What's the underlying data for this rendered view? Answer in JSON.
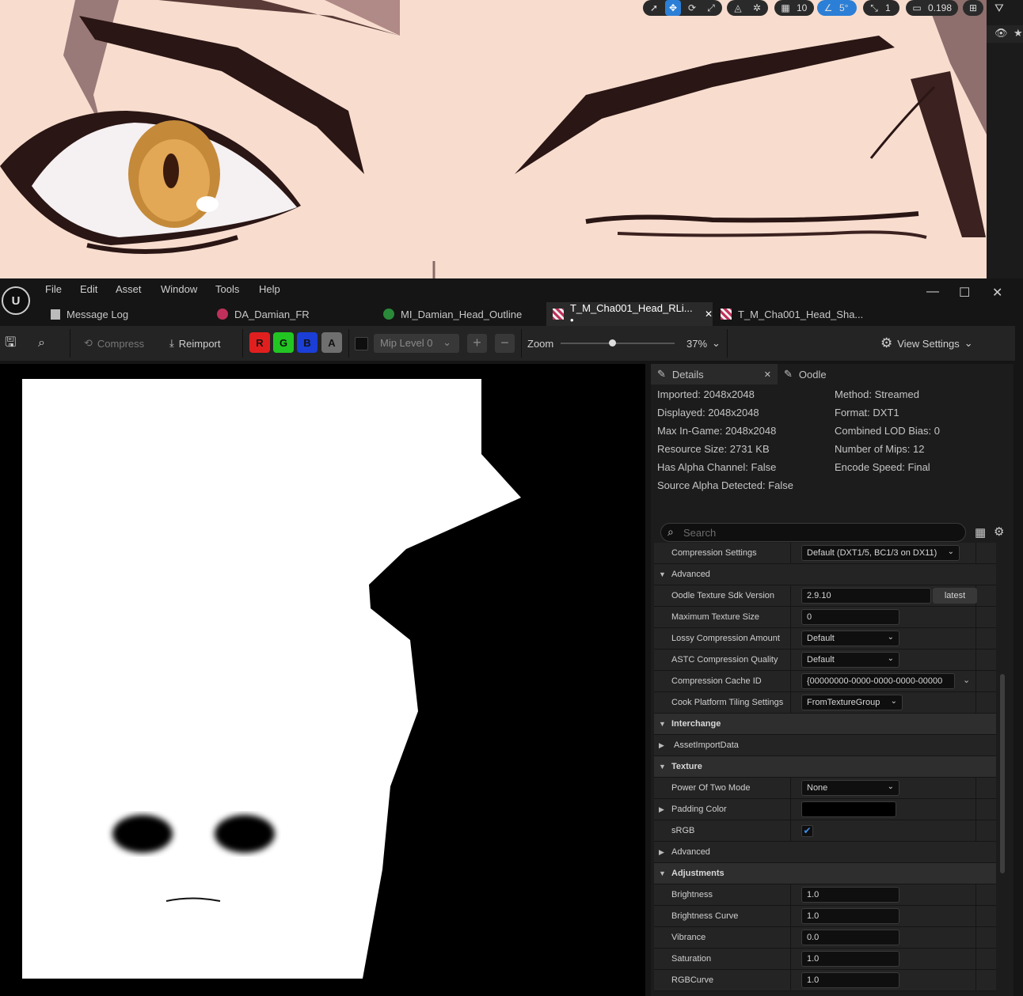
{
  "viewport_toolbar": {
    "grid_snap": "10",
    "rotation_snap": "5°",
    "scale_snap": "1",
    "camera_speed": "0.198"
  },
  "menu": {
    "items": [
      "File",
      "Edit",
      "Asset",
      "Window",
      "Tools",
      "Help"
    ]
  },
  "tabs": [
    {
      "label": "Message Log"
    },
    {
      "label": "DA_Damian_FR"
    },
    {
      "label": "MI_Damian_Head_Outline"
    },
    {
      "label": "T_M_Cha001_Head_RLi... •"
    },
    {
      "label": "T_M_Cha001_Head_Sha..."
    }
  ],
  "toolbar": {
    "compress": "Compress",
    "reimport": "Reimport",
    "channels": [
      "R",
      "G",
      "B",
      "A"
    ],
    "mip_level": "Mip Level 0",
    "zoom_label": "Zoom",
    "zoom_value": "37%",
    "zoom_fraction": 0.45,
    "view_settings": "View Settings"
  },
  "details": {
    "tab_details": "Details",
    "tab_oodle": "Oodle",
    "info_left": [
      "Imported: 2048x2048",
      "Displayed: 2048x2048",
      "Max In-Game: 2048x2048",
      "Resource Size: 2731 KB",
      "Has Alpha Channel: False",
      "Source Alpha Detected: False"
    ],
    "info_right": [
      "Method: Streamed",
      "Format: DXT1",
      "Combined LOD Bias: 0",
      "Number of Mips: 12",
      "Encode Speed: Final"
    ],
    "search_placeholder": "Search",
    "props": {
      "compression_settings": {
        "label": "Compression Settings",
        "value": "Default (DXT1/5, BC1/3 on DX11)"
      },
      "advanced_cat": "Advanced",
      "oodle_sdk": {
        "label": "Oodle Texture Sdk Version",
        "value": "2.9.10",
        "button": "latest"
      },
      "max_texture_size": {
        "label": "Maximum Texture Size",
        "value": "0"
      },
      "lossy_amount": {
        "label": "Lossy Compression Amount",
        "value": "Default"
      },
      "astc_quality": {
        "label": "ASTC Compression Quality",
        "value": "Default"
      },
      "cache_id": {
        "label": "Compression Cache ID",
        "value": "{00000000-0000-0000-0000-00000"
      },
      "tiling": {
        "label": "Cook Platform Tiling Settings",
        "value": "FromTextureGroup"
      },
      "interchange_cat": "Interchange",
      "asset_import": "AssetImportData",
      "texture_cat": "Texture",
      "power_of_two": {
        "label": "Power Of Two Mode",
        "value": "None"
      },
      "padding_color": {
        "label": "Padding Color",
        "color": "#000000"
      },
      "srgb": {
        "label": "sRGB",
        "checked": true
      },
      "advanced2": "Advanced",
      "adjustments_cat": "Adjustments",
      "brightness": {
        "label": "Brightness",
        "value": "1.0"
      },
      "brightness_curve": {
        "label": "Brightness Curve",
        "value": "1.0"
      },
      "vibrance": {
        "label": "Vibrance",
        "value": "0.0"
      },
      "saturation": {
        "label": "Saturation",
        "value": "1.0"
      },
      "rgbcurve": {
        "label": "RGBCurve",
        "value": "1.0"
      }
    }
  }
}
